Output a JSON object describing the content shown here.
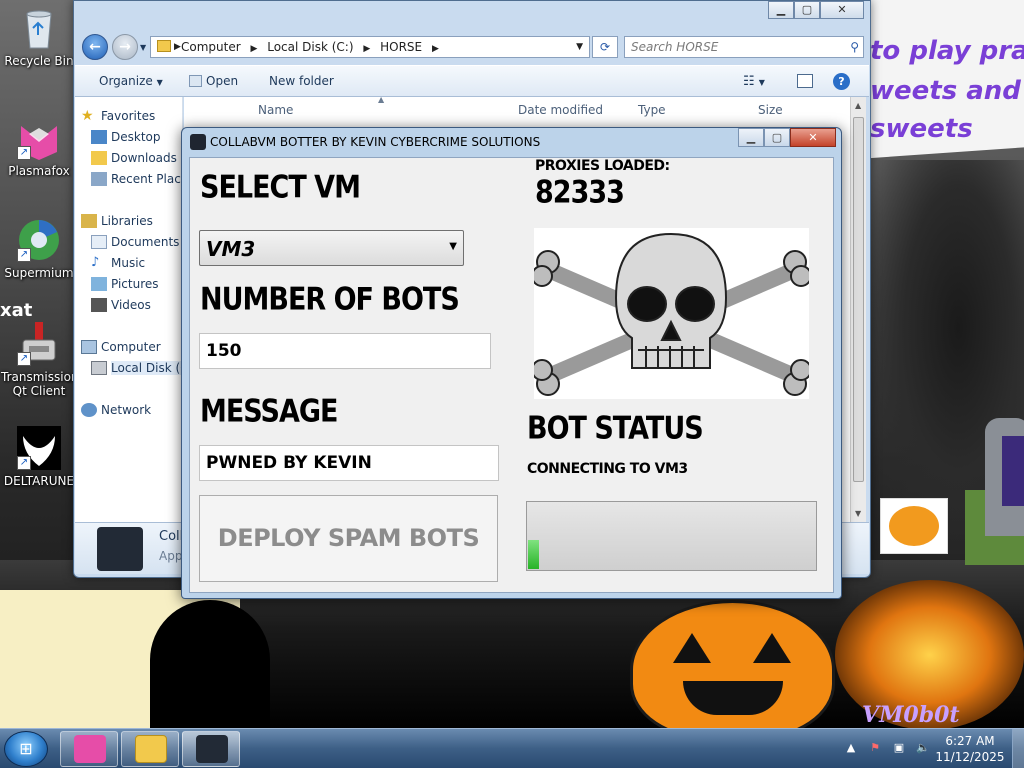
{
  "desktop": {
    "wallpaper": {
      "banner_lines": [
        "to play pra",
        "weets and i",
        "sweets"
      ],
      "xat_text": "xat",
      "signature": "VM0b0t"
    },
    "icons": [
      {
        "label": "Recycle Bin",
        "icon": "recycle-bin-icon"
      },
      {
        "label": "Plasmafox",
        "icon": "plasmafox-icon"
      },
      {
        "label": "Supermium",
        "icon": "supermium-icon"
      },
      {
        "label": "Transmission Qt Client",
        "icon": "transmission-icon"
      },
      {
        "label": "DELTARUNE",
        "icon": "deltarune-icon"
      }
    ]
  },
  "explorer": {
    "address": {
      "crumbs": [
        "Computer",
        "Local Disk (C:)",
        "HORSE"
      ]
    },
    "search_placeholder": "Search HORSE",
    "toolbar": {
      "organize": "Organize",
      "open": "Open",
      "new_folder": "New folder"
    },
    "nav": {
      "favorites": "Favorites",
      "desktop": "Desktop",
      "downloads": "Downloads",
      "recent_places": "Recent Places",
      "libraries": "Libraries",
      "documents": "Documents",
      "music": "Music",
      "pictures": "Pictures",
      "videos": "Videos",
      "computer": "Computer",
      "local_disk": "Local Disk (C:)",
      "network": "Network"
    },
    "columns": [
      "Name",
      "Date modified",
      "Type",
      "Size"
    ],
    "details": {
      "name": "Colla",
      "type": "App"
    }
  },
  "botter": {
    "title": "COLLABVM BOTTER BY KEVIN CYBERCRIME SOLUTIONS",
    "select_vm_label": "SELECT VM",
    "vm_value": "VM3",
    "bots_label": "NUMBER OF BOTS",
    "bots_value": "150",
    "message_label": "MESSAGE",
    "message_value": "PWNED BY KEVIN",
    "deploy_label": "DEPLOY SPAM BOTS",
    "proxies_label": "PROXIES LOADED:",
    "proxies_value": "82333",
    "status_label": "BOT STATUS",
    "status_value": "CONNECTING TO VM3",
    "progress_fraction": 0.04
  },
  "taskbar": {
    "time": "6:27 AM",
    "date": "11/12/2025"
  },
  "colors": {
    "accent": "#2f7fcc",
    "progress_fill": "#27b327",
    "banner_text": "#7a3fd6",
    "pumpkin": "#f28a12"
  }
}
